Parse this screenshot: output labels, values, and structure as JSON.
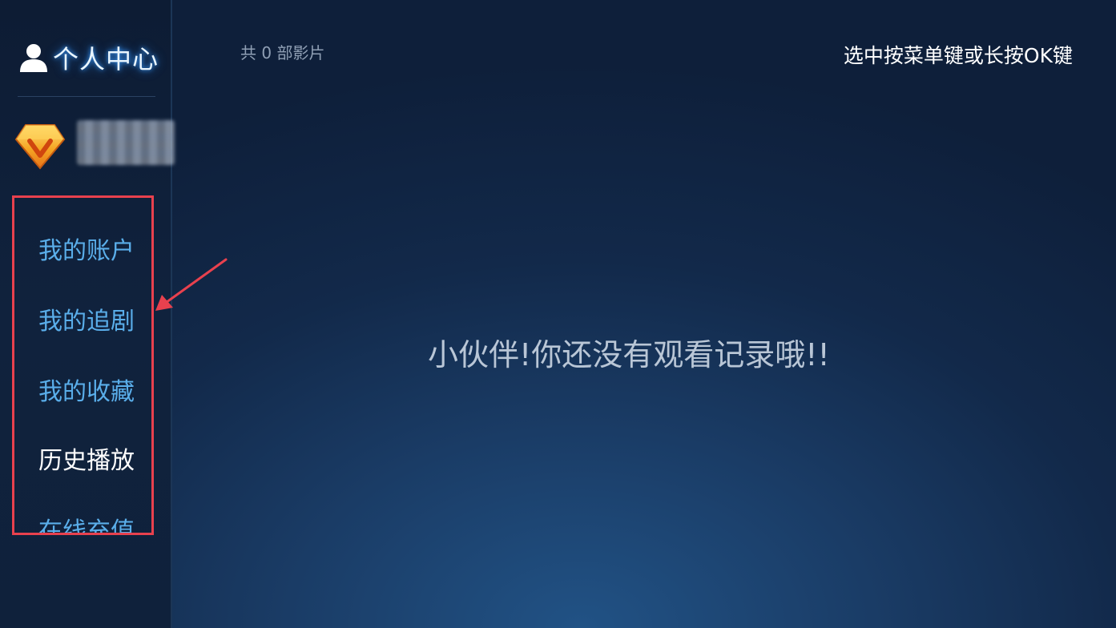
{
  "sidebar": {
    "title": "个人中心",
    "title_icon": "user-icon",
    "vip_icon": "vip-diamond-icon",
    "menu": [
      {
        "label": "我的账户",
        "active": false
      },
      {
        "label": "我的追剧",
        "active": false
      },
      {
        "label": "我的收藏",
        "active": false
      },
      {
        "label": "历史播放",
        "active": true
      },
      {
        "label": "在线充值",
        "active": false
      }
    ]
  },
  "main": {
    "count_label": "共 0 部影片",
    "hint": "选中按菜单键或长按OK键",
    "empty_message": "小伙伴!你还没有观看记录哦!!"
  },
  "colors": {
    "accent_menu": "#5aaeea",
    "highlight_box": "#e8414e",
    "active_item": "#ffffff"
  }
}
